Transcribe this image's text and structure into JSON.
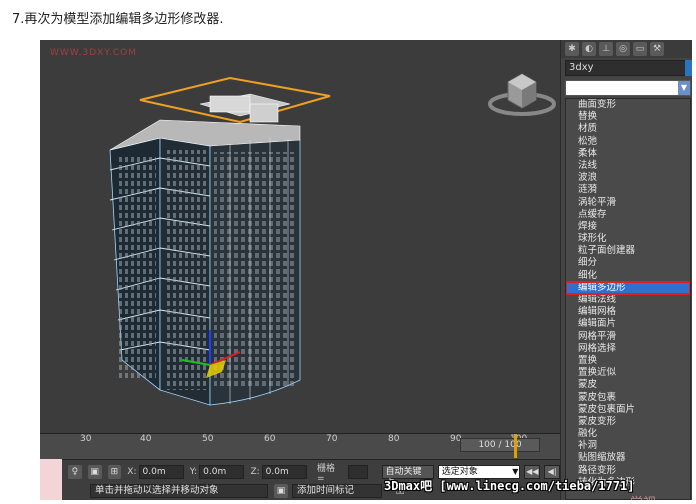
{
  "caption": "7.再次为模型添加编辑多边形修改器.",
  "viewport": {
    "watermark": "WWW.3DXY.COM"
  },
  "panel": {
    "object_name": "3dxy",
    "modifiers": [
      "曲面变形",
      "替换",
      "材质",
      "松弛",
      "柔体",
      "法线",
      "波浪",
      "涟漪",
      "涡轮平滑",
      "点缓存",
      "焊接",
      "球形化",
      "粒子面创建器",
      "细分",
      "细化",
      "编辑多边形",
      "编辑法线",
      "编辑网格",
      "编辑面片",
      "网格平滑",
      "网格选择",
      "置换",
      "置换近似",
      "蒙皮",
      "蒙皮包裹",
      "蒙皮包裹面片",
      "蒙皮变形",
      "融化",
      "补洞",
      "贴图缩放器",
      "路径变形",
      "转化为多边形"
    ],
    "selected_modifier": "编辑多边形"
  },
  "timeline": {
    "ticks": [
      "30",
      "40",
      "50",
      "60",
      "70",
      "80",
      "90",
      "100"
    ],
    "frame": "100 / 100"
  },
  "status": {
    "x_label": "X:",
    "x_value": "0.0m",
    "y_label": "Y:",
    "y_value": "0.0m",
    "z_label": "Z:",
    "z_value": "0.0m",
    "grid_label": "栅格 =",
    "autokey": "自动关键点",
    "selection_set": "选定对象",
    "prompt": "单击并拖动以选择并移动对象",
    "add_time_tag": "添加时间标记"
  },
  "overlay": "3Dmax吧 [www.linecg.com/tieba/1771]",
  "brand_watermark": "学视"
}
